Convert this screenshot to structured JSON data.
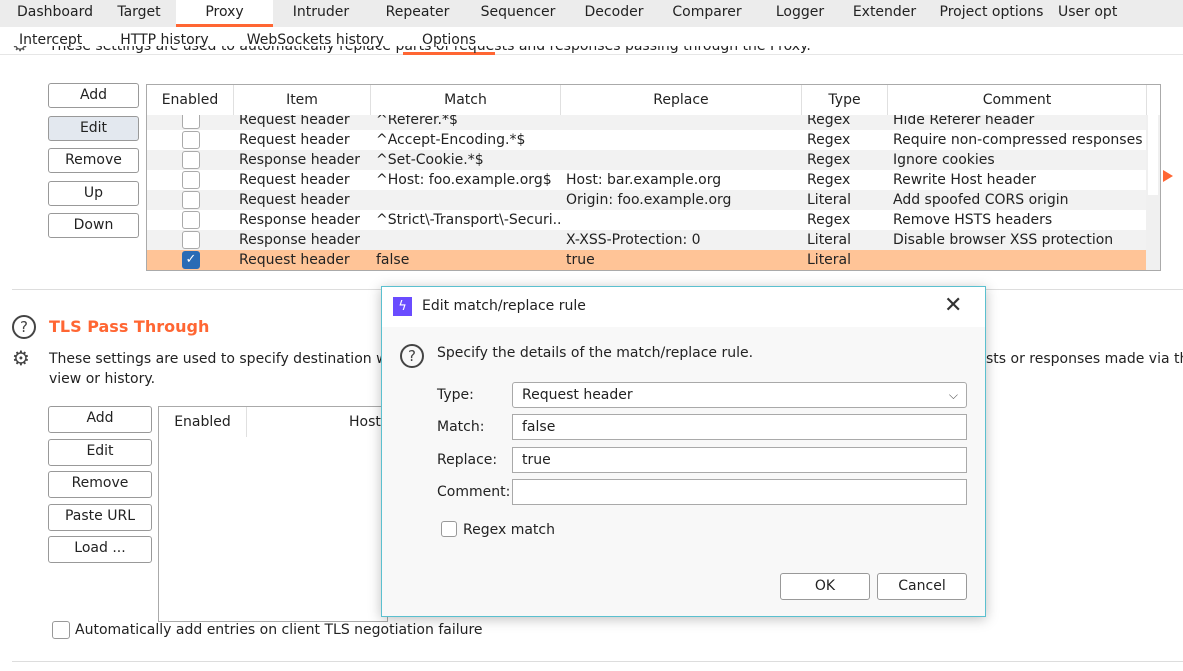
{
  "tabs": [
    "Dashboard",
    "Target",
    "Proxy",
    "Intruder",
    "Repeater",
    "Sequencer",
    "Decoder",
    "Comparer",
    "Logger",
    "Extender",
    "Project options",
    "User opt"
  ],
  "active_tab": "Proxy",
  "subtabs": [
    "Intercept",
    "HTTP history",
    "WebSockets history",
    "Options"
  ],
  "active_subtab": "Options",
  "match_replace": {
    "description": "These settings are used to automatically replace parts of requests and responses passing through the Proxy.",
    "buttons": [
      "Add",
      "Edit",
      "Remove",
      "Up",
      "Down"
    ],
    "columns": [
      "Enabled",
      "Item",
      "Match",
      "Replace",
      "Type",
      "Comment"
    ],
    "rows": [
      {
        "enabled": false,
        "item": "Request header",
        "match": "^Referer.*$",
        "replace": "",
        "type": "Regex",
        "comment": "Hide Referer header"
      },
      {
        "enabled": false,
        "item": "Request header",
        "match": "^Accept-Encoding.*$",
        "replace": "",
        "type": "Regex",
        "comment": "Require non-compressed responses"
      },
      {
        "enabled": false,
        "item": "Response header",
        "match": "^Set-Cookie.*$",
        "replace": "",
        "type": "Regex",
        "comment": "Ignore cookies"
      },
      {
        "enabled": false,
        "item": "Request header",
        "match": "^Host: foo.example.org$",
        "replace": "Host: bar.example.org",
        "type": "Regex",
        "comment": "Rewrite Host header"
      },
      {
        "enabled": false,
        "item": "Request header",
        "match": "",
        "replace": "Origin: foo.example.org",
        "type": "Literal",
        "comment": "Add spoofed CORS origin"
      },
      {
        "enabled": false,
        "item": "Response header",
        "match": "^Strict\\-Transport\\-Securi...",
        "replace": "",
        "type": "Regex",
        "comment": "Remove HSTS headers"
      },
      {
        "enabled": false,
        "item": "Response header",
        "match": "",
        "replace": "X-XSS-Protection: 0",
        "type": "Literal",
        "comment": "Disable browser XSS protection"
      },
      {
        "enabled": true,
        "item": "Request header",
        "match": "false",
        "replace": "true",
        "type": "Literal",
        "comment": "",
        "selected": true
      }
    ]
  },
  "tls": {
    "title": "TLS Pass Through",
    "description_left": "These settings are used to specify destination web",
    "description_right": "sts or responses made via thes",
    "description_line2": "view or history.",
    "buttons": [
      "Add",
      "Edit",
      "Remove",
      "Paste URL",
      "Load ..."
    ],
    "columns": [
      "Enabled",
      "Host"
    ],
    "auto_add_label": "Automatically add entries on client TLS negotiation failure",
    "auto_add_checked": false
  },
  "dialog": {
    "title": "Edit match/replace rule",
    "prompt": "Specify the details of the match/replace rule.",
    "type_label": "Type:",
    "type_value": "Request header",
    "match_label": "Match:",
    "match_value": "false",
    "replace_label": "Replace:",
    "replace_value": "true",
    "comment_label": "Comment:",
    "comment_value": "",
    "regex_label": "Regex match",
    "regex_checked": false,
    "ok": "OK",
    "cancel": "Cancel"
  },
  "colors": {
    "accent": "#ff6633",
    "selected_row": "#ffc497",
    "dialog_icon": "#6a4cff",
    "checkbox_on": "#2a6bb5"
  }
}
